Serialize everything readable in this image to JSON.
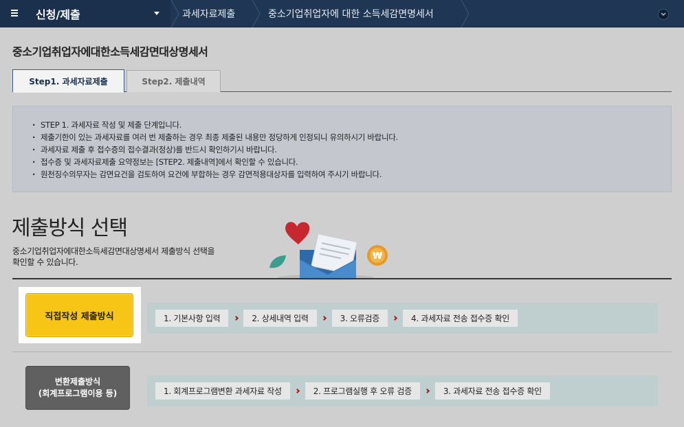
{
  "nav": {
    "menu_label": "신청/제출",
    "breadcrumb": [
      "과세자료제출",
      "중소기업취업자에 대한 소득세감면명세서"
    ]
  },
  "page_title": "중소기업취업자에대한소득세감면대상명세서",
  "tabs": [
    {
      "label": "Step1. 과세자료제출",
      "active": true
    },
    {
      "label": "Step2. 제출내역",
      "active": false
    }
  ],
  "notice": [
    "STEP 1. 과세자료 작성 및 제출 단계입니다.",
    "제출기한이 있는 과세자료를 여러 번 제출하는 경우 최종 제출된 내용만 정당하게 인정되니 유의하시기 바랍니다.",
    "과세자료 제출 후 접수증의 접수결과(정상)를 반드시 확인하기시 바랍니다.",
    "접수증 및 과세자료제출 요약정보는 [STEP2. 제출내역]에서 확인할 수 있습니다.",
    "원천징수의무자는 감면요건을 검토하여 요건에 부합하는 경우 감면적용대상자를 입력하여 주시기 바랍니다."
  ],
  "section": {
    "title": "제출방식 선택",
    "desc_line1": "중소기업취업자에대한소득세감면대상명세서 제출방식 선택을",
    "desc_line2": "확인할 수 있습니다."
  },
  "methods": {
    "direct": {
      "label": "직접작성 제출방식",
      "steps": [
        "1. 기본사항 입력",
        "2. 상세내역 입력",
        "3. 오류검증",
        "4. 과세자료 전송 접수증 확인"
      ]
    },
    "convert": {
      "label_line1": "변환제출방식",
      "label_line2": "(회계프로그램이용 등)",
      "steps": [
        "1. 회계프로그램변환 과세자료 작성",
        "2. 프로그램실행 후 오류 검증",
        "3. 과세자료 전송 접수증 확인"
      ]
    }
  },
  "colors": {
    "nav_bg": "#1f3654",
    "direct_button": "#f7c516",
    "convert_button": "#606060",
    "flow_bg": "#bfcfcf",
    "arrow": "#b01818"
  }
}
